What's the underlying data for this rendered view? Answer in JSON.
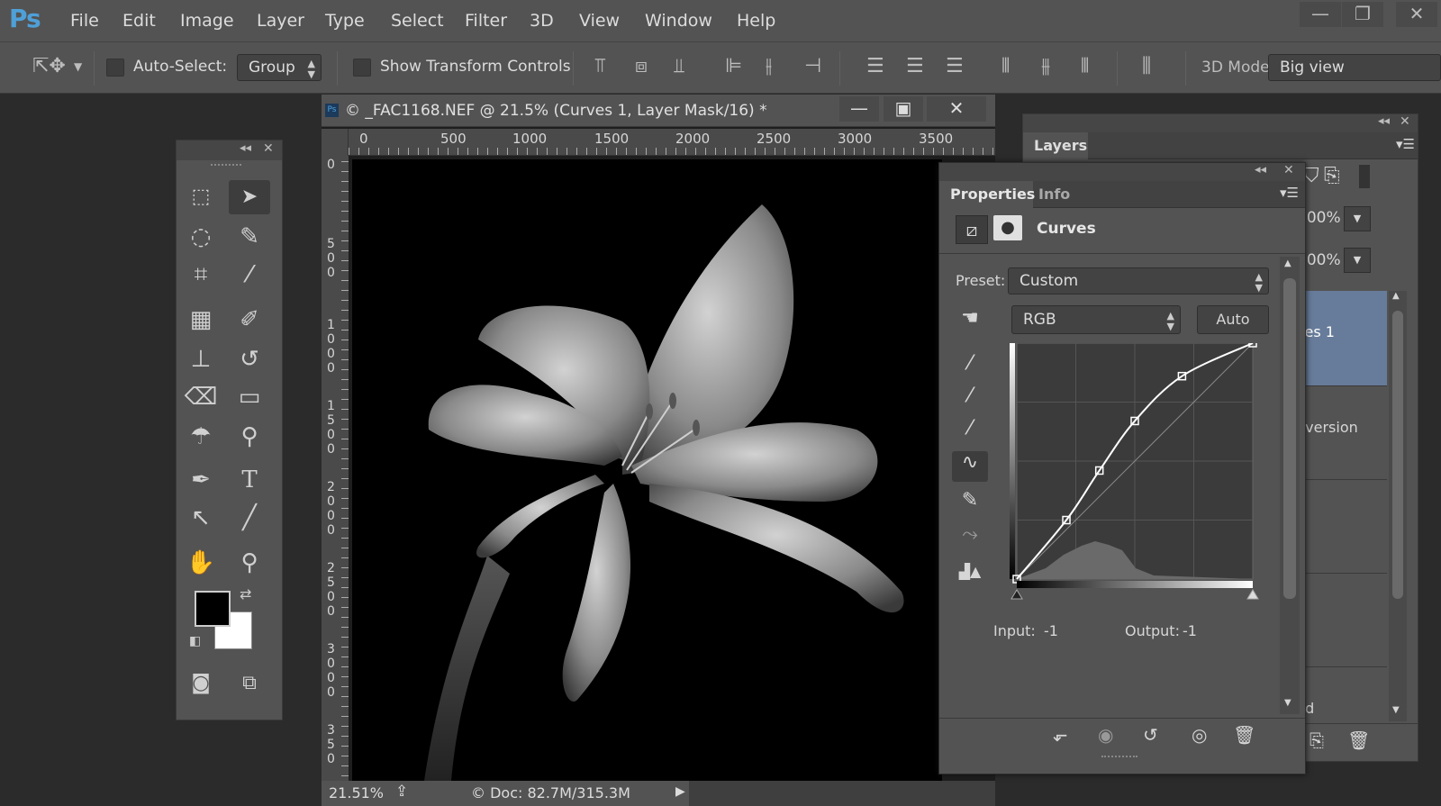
{
  "app": {
    "logo": "Ps"
  },
  "menu": [
    "File",
    "Edit",
    "Image",
    "Layer",
    "Type",
    "Select",
    "Filter",
    "3D",
    "View",
    "Window",
    "Help"
  ],
  "window_controls": {
    "minimize": "—",
    "restore": "❐",
    "close": "✕"
  },
  "options": {
    "auto_select_label": "Auto-Select:",
    "auto_select_value": "Group",
    "show_transform_label": "Show Transform Controls",
    "mode_3d_label": "3D Mode",
    "mode_3d_value": "Big view"
  },
  "document": {
    "title": "© _FAC1168.NEF @ 21.5% (Curves 1, Layer Mask/16) *",
    "ruler_h": [
      "0",
      "500",
      "1000",
      "1500",
      "2000",
      "2500",
      "3000",
      "3500"
    ],
    "ruler_v": [
      "0",
      "5 0 0",
      "1 0 0 0",
      "1 5 0 0",
      "2 0 0 0",
      "2 5 0 0",
      "3 0 0 0",
      "3 5 0"
    ],
    "zoom": "21.51%",
    "doc_size": "© Doc: 82.7M/315.3M"
  },
  "layers_panel": {
    "tab": "Layers",
    "opacity": "100%",
    "fill": "100%",
    "layer1": "ves 1",
    "layer2": "nversion",
    "layer3": "nd"
  },
  "properties": {
    "tab_active": "Properties",
    "tab_info": "Info",
    "heading": "Curves",
    "preset_label": "Preset:",
    "preset_value": "Custom",
    "channel": "RGB",
    "auto_label": "Auto",
    "input_label": "Input:",
    "input_value": "-1",
    "output_label": "Output:",
    "output_value": "-1",
    "curve_points": [
      [
        0,
        0
      ],
      [
        0.21,
        0.25
      ],
      [
        0.35,
        0.46
      ],
      [
        0.5,
        0.67
      ],
      [
        0.7,
        0.86
      ],
      [
        1,
        1
      ]
    ]
  }
}
